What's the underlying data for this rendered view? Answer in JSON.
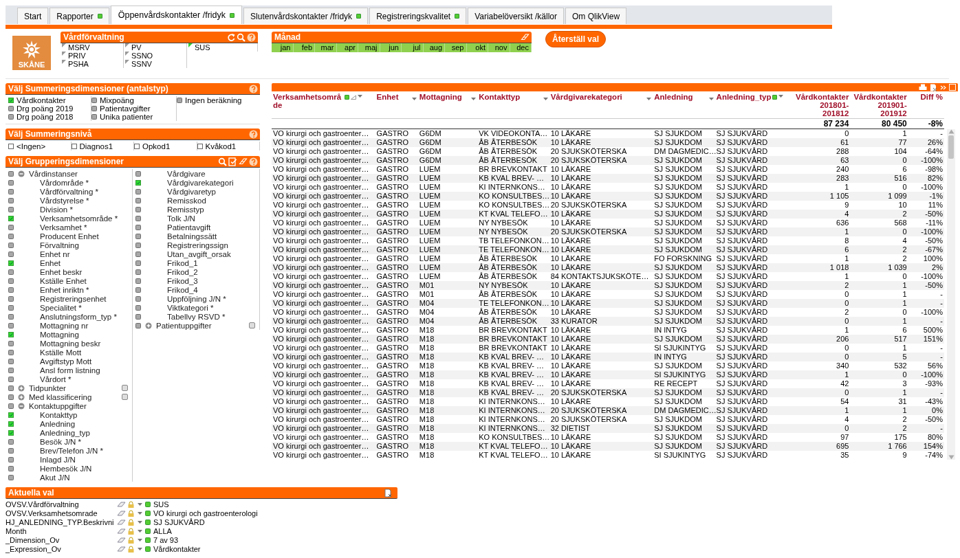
{
  "tabs": [
    {
      "label": "Start",
      "selected": false,
      "indicator": false
    },
    {
      "label": "Rapporter",
      "selected": false,
      "indicator": true
    },
    {
      "label": "Öppenvårdskontakter /fridyk",
      "selected": true,
      "indicator": true
    },
    {
      "label": "Slutenvårdskontakter /fridyk",
      "selected": false,
      "indicator": true
    },
    {
      "label": "Registreringskvalitet",
      "selected": false,
      "indicator": true
    },
    {
      "label": "Variabelöversikt /källor",
      "selected": false,
      "indicator": false
    },
    {
      "label": "Om QlikView",
      "selected": false,
      "indicator": false
    }
  ],
  "logo": {
    "text": "SKÅNE"
  },
  "vardforvaltning": {
    "title": "Vårdförvaltning",
    "items": [
      {
        "label": "MSRV",
        "selected": false
      },
      {
        "label": "PRIV",
        "selected": false
      },
      {
        "label": "PSHA",
        "selected": false
      },
      {
        "label": "PV",
        "selected": false
      },
      {
        "label": "SSNO",
        "selected": false
      },
      {
        "label": "SSNV",
        "selected": false
      },
      {
        "label": "SUS",
        "selected": true
      }
    ]
  },
  "manad": {
    "title": "Månad",
    "months": [
      {
        "label": "jan",
        "selected": true
      },
      {
        "label": "feb",
        "selected": true
      },
      {
        "label": "mar",
        "selected": true
      },
      {
        "label": "apr",
        "selected": true
      },
      {
        "label": "maj",
        "selected": true
      },
      {
        "label": "jun",
        "selected": true
      },
      {
        "label": "jul",
        "selected": true
      },
      {
        "label": "aug",
        "selected": true
      },
      {
        "label": "sep",
        "selected": true
      },
      {
        "label": "okt",
        "selected": true
      },
      {
        "label": "nov",
        "selected": true
      },
      {
        "label": "dec",
        "selected": true
      }
    ]
  },
  "reset_button": "Återställ val",
  "summering": {
    "title": "Välj Summeringsdimensioner (antalstyp)",
    "items": [
      {
        "label": "Vårdkontakter",
        "selected": true
      },
      {
        "label": "Drg poäng 2019",
        "selected": false
      },
      {
        "label": "Drg poäng 2018",
        "selected": false
      },
      {
        "label": "Mixpoäng",
        "selected": false
      },
      {
        "label": "Patientavgifter",
        "selected": false
      },
      {
        "label": "Unika patienter",
        "selected": false
      },
      {
        "label": "Ingen beräkning",
        "selected": false
      }
    ]
  },
  "niva": {
    "title": "Välj Summeringsnivå",
    "items": [
      {
        "label": "<Ingen>",
        "checked": false
      },
      {
        "label": "Diagnos1",
        "checked": false
      },
      {
        "label": "Opkod1",
        "checked": false
      },
      {
        "label": "Kvåkod1",
        "checked": false
      }
    ]
  },
  "gruppering": {
    "title": "Välj Grupperingsdimensioner",
    "groups": [
      {
        "label": "Vårdinstanser",
        "selected": false,
        "expanded": true,
        "children": [
          {
            "label": "Vårdområde *",
            "selected": false
          },
          {
            "label": "Vårdförvaltning *",
            "selected": false
          },
          {
            "label": "Vårdstyrelse *",
            "selected": false
          },
          {
            "label": "Division *",
            "selected": false
          },
          {
            "label": "Verksamhetsområde *",
            "selected": true
          },
          {
            "label": "Verksamhet *",
            "selected": false
          },
          {
            "label": "Producent Enhet",
            "selected": false
          },
          {
            "label": "Förvaltning",
            "selected": false
          },
          {
            "label": "Enhet nr",
            "selected": false
          },
          {
            "label": "Enhet",
            "selected": true
          },
          {
            "label": "Enhet beskr",
            "selected": false
          },
          {
            "label": "Kställe Enhet",
            "selected": false
          },
          {
            "label": "Enhet inriktn *",
            "selected": false
          },
          {
            "label": "Registreringsenhet",
            "selected": false
          },
          {
            "label": "Specialitet *",
            "selected": false
          },
          {
            "label": "Anslutningsform_typ *",
            "selected": false
          },
          {
            "label": "Mottagning nr",
            "selected": false
          },
          {
            "label": "Mottagning",
            "selected": true
          },
          {
            "label": "Mottagning beskr",
            "selected": false
          },
          {
            "label": "Kställe Mott",
            "selected": false
          },
          {
            "label": "Avgiftstyp Mott",
            "selected": false
          },
          {
            "label": "Ansl form listning",
            "selected": false
          },
          {
            "label": "Vårdort *",
            "selected": false
          }
        ]
      },
      {
        "label": "Tidpunkter",
        "selected": false,
        "expanded": false
      },
      {
        "label": "Med klassificering",
        "selected": false,
        "expanded": false
      },
      {
        "label": "Kontaktuppgifter",
        "selected": false,
        "expanded": true,
        "children": [
          {
            "label": "Kontakttyp",
            "selected": true
          },
          {
            "label": "Anledning",
            "selected": true
          },
          {
            "label": "Anledning_typ",
            "selected": true
          },
          {
            "label": "Besök J/N *",
            "selected": false
          },
          {
            "label": "Brev/Telefon J/N *",
            "selected": false
          },
          {
            "label": "Inlagd J/N",
            "selected": false
          },
          {
            "label": "Hembesök J/N",
            "selected": false
          },
          {
            "label": "Akut J/N",
            "selected": false
          },
          {
            "label": "Vårdgivare",
            "selected": false
          },
          {
            "label": "Vårdgivarekategori",
            "selected": true
          },
          {
            "label": "Vårdgivaretyp",
            "selected": false
          },
          {
            "label": "Remisskod",
            "selected": false
          },
          {
            "label": "Remisstyp",
            "selected": false
          },
          {
            "label": "Tolk J/N",
            "selected": false
          },
          {
            "label": "Patientavgift",
            "selected": false
          },
          {
            "label": "Betalningssätt",
            "selected": false
          },
          {
            "label": "Registreringssign",
            "selected": false
          },
          {
            "label": "Utan_avgift_orsak",
            "selected": false
          },
          {
            "label": "Frikod_1",
            "selected": false
          },
          {
            "label": "Frikod_2",
            "selected": false
          },
          {
            "label": "Frikod_3",
            "selected": false
          },
          {
            "label": "Frikod_4",
            "selected": false
          },
          {
            "label": "Uppföljning J/N *",
            "selected": false
          },
          {
            "label": "Viktkategori *",
            "selected": false
          },
          {
            "label": "Tabellvy RSVD *",
            "selected": false
          }
        ]
      },
      {
        "label": "Patientuppgifter",
        "selected": false,
        "expanded": false
      }
    ]
  },
  "current_selections": {
    "title": "Aktuella val",
    "rows": [
      {
        "field": "OVSV.Vårdförvaltning",
        "value": "SUS"
      },
      {
        "field": "OVSV.Verksamhetsomrade",
        "value": "VO kirurgi och gastroenterologi"
      },
      {
        "field": "HJ_ANLEDNING_TYP.Beskrivni",
        "value": "SJ SJUKVÅRD"
      },
      {
        "field": "Month",
        "value": "ALLA"
      },
      {
        "field": "_Dimension_Ov",
        "value": "7 av 93"
      },
      {
        "field": "_Expression_Ov",
        "value": "Vårdkontakter"
      }
    ]
  },
  "table": {
    "columns": [
      {
        "label": "Verksamhetsområde",
        "filtered": true,
        "sorted": true,
        "menu": true
      },
      {
        "label": "Enhet",
        "filtered": false,
        "sorted": false,
        "menu": true
      },
      {
        "label": "Mottagning",
        "filtered": false,
        "sorted": false,
        "menu": true
      },
      {
        "label": "Kontakttyp",
        "filtered": false,
        "sorted": false,
        "menu": true
      },
      {
        "label": "Vårdgivarekategori",
        "filtered": false,
        "sorted": false,
        "menu": true
      },
      {
        "label": "Anledning",
        "filtered": false,
        "sorted": false,
        "menu": true
      },
      {
        "label": "Anledning_typ",
        "filtered": true,
        "sorted": false,
        "menu": true
      },
      {
        "label": "Vårdkontakter 201801-201812",
        "filtered": false,
        "sorted": false,
        "menu": false
      },
      {
        "label": "Vårdkontakter 201901-201912",
        "filtered": false,
        "sorted": false,
        "menu": false
      },
      {
        "label": "Diff %",
        "filtered": false,
        "sorted": false,
        "menu": false
      }
    ],
    "totals": [
      "87 234",
      "80 450",
      "-8%"
    ],
    "rows": [
      [
        "VO kirurgi och gastroenter…",
        "GASTRO",
        "G6DM",
        "VK VIDEOKONTA…",
        "10 LÄKARE",
        "SJ SJUKDOM",
        "SJ SJUKVÅRD",
        "0",
        "1",
        "-"
      ],
      [
        "VO kirurgi och gastroenter…",
        "GASTRO",
        "G6DM",
        "ÅB ÅTERBESÖK",
        "10 LÄKARE",
        "SJ SJUKDOM",
        "SJ SJUKVÅRD",
        "61",
        "77",
        "26%"
      ],
      [
        "VO kirurgi och gastroenter…",
        "GASTRO",
        "G6DM",
        "ÅB ÅTERBESÖK",
        "20 SJUKSKÖTERSKA",
        "DM DAGMEDIC…",
        "SJ SJUKVÅRD",
        "288",
        "104",
        "-64%"
      ],
      [
        "VO kirurgi och gastroenter…",
        "GASTRO",
        "G6DM",
        "ÅB ÅTERBESÖK",
        "20 SJUKSKÖTERSKA",
        "SJ SJUKDOM",
        "SJ SJUKVÅRD",
        "63",
        "0",
        "-100%"
      ],
      [
        "VO kirurgi och gastroenter…",
        "GASTRO",
        "LUEM",
        "BR BREVKONTAKT",
        "10 LÄKARE",
        "SJ SJUKDOM",
        "SJ SJUKVÅRD",
        "240",
        "6",
        "-98%"
      ],
      [
        "VO kirurgi och gastroenter…",
        "GASTRO",
        "LUEM",
        "KB KVAL BREV- …",
        "10 LÄKARE",
        "SJ SJUKDOM",
        "SJ SJUKVÅRD",
        "283",
        "516",
        "82%"
      ],
      [
        "VO kirurgi och gastroenter…",
        "GASTRO",
        "LUEM",
        "KI INTERNKONS…",
        "10 LÄKARE",
        "SJ SJUKDOM",
        "SJ SJUKVÅRD",
        "1",
        "0",
        "-100%"
      ],
      [
        "VO kirurgi och gastroenter…",
        "GASTRO",
        "LUEM",
        "KO KONSULTBES…",
        "10 LÄKARE",
        "SJ SJUKDOM",
        "SJ SJUKVÅRD",
        "1 105",
        "1 099",
        "-1%"
      ],
      [
        "VO kirurgi och gastroenter…",
        "GASTRO",
        "LUEM",
        "KO KONSULTBES…",
        "20 SJUKSKÖTERSKA",
        "SJ SJUKDOM",
        "SJ SJUKVÅRD",
        "9",
        "10",
        "11%"
      ],
      [
        "VO kirurgi och gastroenter…",
        "GASTRO",
        "LUEM",
        "KT KVAL TELEFO…",
        "10 LÄKARE",
        "SJ SJUKDOM",
        "SJ SJUKVÅRD",
        "4",
        "2",
        "-50%"
      ],
      [
        "VO kirurgi och gastroenter…",
        "GASTRO",
        "LUEM",
        "NY NYBESÖK",
        "10 LÄKARE",
        "SJ SJUKDOM",
        "SJ SJUKVÅRD",
        "636",
        "568",
        "-11%"
      ],
      [
        "VO kirurgi och gastroenter…",
        "GASTRO",
        "LUEM",
        "NY NYBESÖK",
        "20 SJUKSKÖTERSKA",
        "SJ SJUKDOM",
        "SJ SJUKVÅRD",
        "1",
        "0",
        "-100%"
      ],
      [
        "VO kirurgi och gastroenter…",
        "GASTRO",
        "LUEM",
        "TB TELEFONKON…",
        "10 LÄKARE",
        "SJ SJUKDOM",
        "SJ SJUKVÅRD",
        "8",
        "4",
        "-50%"
      ],
      [
        "VO kirurgi och gastroenter…",
        "GASTRO",
        "LUEM",
        "TE TELEFONKON…",
        "10 LÄKARE",
        "SJ SJUKDOM",
        "SJ SJUKVÅRD",
        "6",
        "2",
        "-67%"
      ],
      [
        "VO kirurgi och gastroenter…",
        "GASTRO",
        "LUEM",
        "ÅB ÅTERBESÖK",
        "10 LÄKARE",
        "FO FORSKNING",
        "SJ SJUKVÅRD",
        "1",
        "2",
        "100%"
      ],
      [
        "VO kirurgi och gastroenter…",
        "GASTRO",
        "LUEM",
        "ÅB ÅTERBESÖK",
        "10 LÄKARE",
        "SJ SJUKDOM",
        "SJ SJUKVÅRD",
        "1 018",
        "1 039",
        "2%"
      ],
      [
        "VO kirurgi och gastroenter…",
        "GASTRO",
        "LUEM",
        "ÅB ÅTERBESÖK",
        "84 KONTAKTSJUKSKÖTE…",
        "SJ SJUKDOM",
        "SJ SJUKVÅRD",
        "1",
        "0",
        "-100%"
      ],
      [
        "VO kirurgi och gastroenter…",
        "GASTRO",
        "M01",
        "NY NYBESÖK",
        "10 LÄKARE",
        "SJ SJUKDOM",
        "SJ SJUKVÅRD",
        "2",
        "1",
        "-50%"
      ],
      [
        "VO kirurgi och gastroenter…",
        "GASTRO",
        "M01",
        "ÅB ÅTERBESÖK",
        "10 LÄKARE",
        "SJ SJUKDOM",
        "SJ SJUKVÅRD",
        "0",
        "1",
        "-"
      ],
      [
        "VO kirurgi och gastroenter…",
        "GASTRO",
        "M04",
        "TE TELEFONKON…",
        "10 LÄKARE",
        "SJ SJUKDOM",
        "SJ SJUKVÅRD",
        "0",
        "1",
        "-"
      ],
      [
        "VO kirurgi och gastroenter…",
        "GASTRO",
        "M04",
        "ÅB ÅTERBESÖK",
        "10 LÄKARE",
        "SJ SJUKDOM",
        "SJ SJUKVÅRD",
        "2",
        "0",
        "-100%"
      ],
      [
        "VO kirurgi och gastroenter…",
        "GASTRO",
        "M04",
        "ÅB ÅTERBESÖK",
        "33 KURATOR",
        "SJ SJUKDOM",
        "SJ SJUKVÅRD",
        "0",
        "1",
        "-"
      ],
      [
        "VO kirurgi och gastroenter…",
        "GASTRO",
        "M18",
        "BR BREVKONTAKT",
        "10 LÄKARE",
        "IN INTYG",
        "SJ SJUKVÅRD",
        "1",
        "6",
        "500%"
      ],
      [
        "VO kirurgi och gastroenter…",
        "GASTRO",
        "M18",
        "BR BREVKONTAKT",
        "10 LÄKARE",
        "SJ SJUKDOM",
        "SJ SJUKVÅRD",
        "206",
        "517",
        "151%"
      ],
      [
        "VO kirurgi och gastroenter…",
        "GASTRO",
        "M18",
        "BR BREVKONTAKT",
        "10 LÄKARE",
        "SI SJUKINTYG",
        "SJ SJUKVÅRD",
        "0",
        "1",
        "-"
      ],
      [
        "VO kirurgi och gastroenter…",
        "GASTRO",
        "M18",
        "KB KVAL BREV- …",
        "10 LÄKARE",
        "IN INTYG",
        "SJ SJUKVÅRD",
        "0",
        "5",
        "-"
      ],
      [
        "VO kirurgi och gastroenter…",
        "GASTRO",
        "M18",
        "KB KVAL BREV- …",
        "10 LÄKARE",
        "SJ SJUKDOM",
        "SJ SJUKVÅRD",
        "340",
        "532",
        "56%"
      ],
      [
        "VO kirurgi och gastroenter…",
        "GASTRO",
        "M18",
        "KB KVAL BREV- …",
        "10 LÄKARE",
        "SI SJUKINTYG",
        "SJ SJUKVÅRD",
        "1",
        "0",
        "-100%"
      ],
      [
        "VO kirurgi och gastroenter…",
        "GASTRO",
        "M18",
        "KB KVAL BREV- …",
        "10 LÄKARE",
        "RE RECEPT",
        "SJ SJUKVÅRD",
        "42",
        "3",
        "-93%"
      ],
      [
        "VO kirurgi och gastroenter…",
        "GASTRO",
        "M18",
        "KB KVAL BREV- …",
        "20 SJUKSKÖTERSKA",
        "SJ SJUKDOM",
        "SJ SJUKVÅRD",
        "0",
        "1",
        "-"
      ],
      [
        "VO kirurgi och gastroenter…",
        "GASTRO",
        "M18",
        "KI INTERNKONS…",
        "10 LÄKARE",
        "SJ SJUKDOM",
        "SJ SJUKVÅRD",
        "54",
        "31",
        "-43%"
      ],
      [
        "VO kirurgi och gastroenter…",
        "GASTRO",
        "M18",
        "KI INTERNKONS…",
        "20 SJUKSKÖTERSKA",
        "DM DAGMEDIC…",
        "SJ SJUKVÅRD",
        "1",
        "1",
        "0%"
      ],
      [
        "VO kirurgi och gastroenter…",
        "GASTRO",
        "M18",
        "KI INTERNKONS…",
        "20 SJUKSKÖTERSKA",
        "SJ SJUKDOM",
        "SJ SJUKVÅRD",
        "4",
        "2",
        "-50%"
      ],
      [
        "VO kirurgi och gastroenter…",
        "GASTRO",
        "M18",
        "KI INTERNKONS…",
        "32 DIETIST",
        "SJ SJUKDOM",
        "SJ SJUKVÅRD",
        "0",
        "2",
        "-"
      ],
      [
        "VO kirurgi och gastroenter…",
        "GASTRO",
        "M18",
        "KO KONSULTBES…",
        "10 LÄKARE",
        "SJ SJUKDOM",
        "SJ SJUKVÅRD",
        "97",
        "175",
        "80%"
      ],
      [
        "VO kirurgi och gastroenter…",
        "GASTRO",
        "M18",
        "KT KVAL TELEFO…",
        "10 LÄKARE",
        "SJ SJUKDOM",
        "SJ SJUKVÅRD",
        "695",
        "1 766",
        "154%"
      ],
      [
        "VO kirurgi och gastroenter…",
        "GASTRO",
        "M18",
        "KT KVAL TELEFO…",
        "10 LÄKARE",
        "SI SJUKINTYG",
        "SJ SJUKVÅRD",
        "35",
        "9",
        "-74%"
      ]
    ]
  }
}
